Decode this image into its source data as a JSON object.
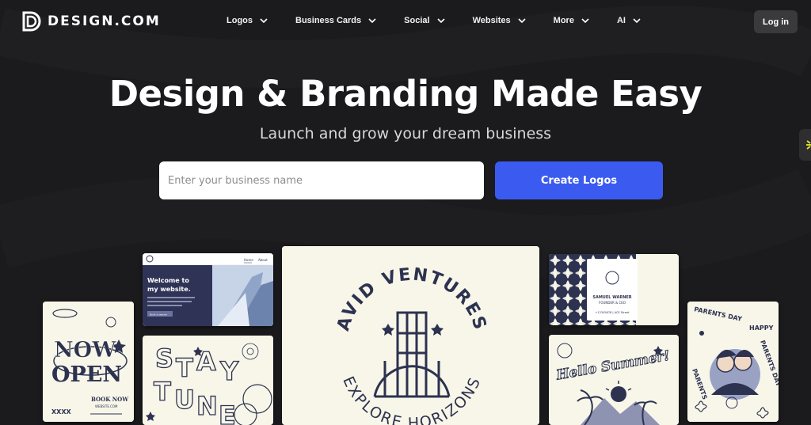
{
  "brand": {
    "name": "DESIGN.COM"
  },
  "nav": {
    "items": [
      {
        "label": "Logos"
      },
      {
        "label": "Business Cards"
      },
      {
        "label": "Social"
      },
      {
        "label": "Websites"
      },
      {
        "label": "More"
      },
      {
        "label": "AI"
      }
    ],
    "login_label": "Log in"
  },
  "hero": {
    "title": "Design & Branding Made Easy",
    "subtitle": "Launch and grow your dream business",
    "input_placeholder": "Enter your business name",
    "cta_label": "Create Logos"
  },
  "cards": {
    "now_open": {
      "line1": "NOW",
      "line2": "OPEN",
      "cta": "BOOK NOW",
      "url": "WEBSITE.COM",
      "marks": "XXXX"
    },
    "website": {
      "nav1": "Home",
      "nav2": "About",
      "heading": "Welcome to my website.",
      "button": "Book a session"
    },
    "stay_tuned": {
      "text": "STAY TUNED"
    },
    "avid": {
      "name": "AVID VENTURES",
      "tagline": "EXPLORE HORIZONS"
    },
    "business_card": {
      "name": "SAMUEL WARNER",
      "role": "FOUNDER & CEO",
      "contact": "+12345678 | ACE Street"
    },
    "hello_summer": {
      "text": "Hello Summer!"
    },
    "parents_day": {
      "text": "PARENTS DAY",
      "happy": "HAPPY"
    }
  },
  "colors": {
    "accent": "#3b5bf0",
    "ink": "#2d3250",
    "paper": "#f7f6e9",
    "background": "#1b1b1d"
  }
}
